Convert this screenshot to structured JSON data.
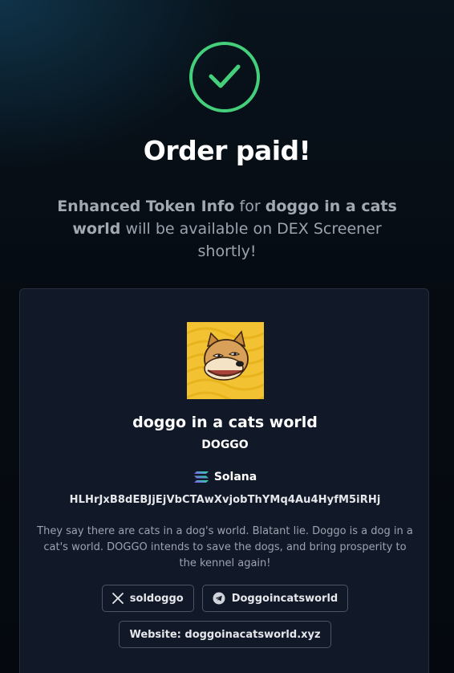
{
  "header": {
    "title": "Order paid!",
    "subtitle": {
      "product": "Enhanced Token Info",
      "for_text": " for ",
      "token": "doggo in a cats world",
      "rest": " will be available on DEX Screener shortly!"
    }
  },
  "colors": {
    "success": "#44d07a",
    "card_bg": "#111827",
    "token_bg": "#f2c232"
  },
  "token": {
    "name": "doggo in a cats world",
    "symbol": "DOGGO",
    "chain": "Solana",
    "address": "HLHrJxB8dEBJjEjVbCTAwXvjobThYMq4Au4HyfM5iRHj",
    "description": "They say there are cats in a dog's world. Blatant lie. Doggo is a dog in a cat's world. DOGGO intends to save the dogs, and bring prosperity to the kennel again!",
    "image_icon": "doge-meme-icon"
  },
  "links": {
    "twitter": {
      "label": "soldoggo",
      "icon": "x-icon"
    },
    "telegram": {
      "label": "Doggoincatsworld",
      "icon": "telegram-icon"
    },
    "website": {
      "label": "Website: doggoinacatsworld.xyz"
    }
  }
}
